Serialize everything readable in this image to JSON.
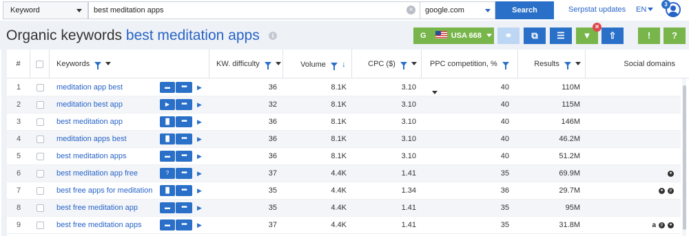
{
  "search": {
    "type_select": "Keyword",
    "query": "best meditation apps",
    "database": "google.com",
    "search_label": "Search"
  },
  "nav": {
    "updates_link": "Serpstat updates",
    "lang": "EN",
    "notif_count": "3"
  },
  "page": {
    "title_prefix": "Organic keywords",
    "title_query": "best meditation apps",
    "info_glyph": "i"
  },
  "toolbar": {
    "db_letter": "G",
    "db_label": "USA 668"
  },
  "table": {
    "headers": {
      "num": "#",
      "keywords": "Keywords",
      "difficulty": "KW. difficulty",
      "volume": "Volume",
      "cpc": "CPC ($)",
      "competition": "PPC competition, %",
      "results": "Results",
      "social": "Social domains"
    },
    "rows": [
      {
        "n": "1",
        "kw": "meditation app best",
        "diff": "36",
        "vol": "8.1K",
        "cpc": "3.10",
        "comp": "40",
        "res": "110M",
        "feature": "speech-bubble-icon",
        "social": []
      },
      {
        "n": "2",
        "kw": "meditation best app",
        "diff": "32",
        "vol": "8.1K",
        "cpc": "3.10",
        "comp": "40",
        "res": "115M",
        "feature": "video-icon",
        "social": []
      },
      {
        "n": "3",
        "kw": "best meditation app",
        "diff": "36",
        "vol": "8.1K",
        "cpc": "3.10",
        "comp": "40",
        "res": "146M",
        "feature": "columns-icon",
        "social": []
      },
      {
        "n": "4",
        "kw": "meditation apps best",
        "diff": "36",
        "vol": "8.1K",
        "cpc": "3.10",
        "comp": "40",
        "res": "46.2M",
        "feature": "columns-icon",
        "social": []
      },
      {
        "n": "5",
        "kw": "best meditation apps",
        "diff": "36",
        "vol": "8.1K",
        "cpc": "3.10",
        "comp": "40",
        "res": "51.2M",
        "feature": "speech-bubble-icon",
        "social": []
      },
      {
        "n": "6",
        "kw": "best meditation app free",
        "diff": "37",
        "vol": "4.4K",
        "cpc": "1.41",
        "comp": "35",
        "res": "69.9M",
        "feature": "question-icon",
        "social": [
          "reddit-icon"
        ]
      },
      {
        "n": "7",
        "kw": "best free apps for meditation",
        "diff": "35",
        "vol": "4.4K",
        "cpc": "1.34",
        "comp": "36",
        "res": "29.7M",
        "feature": "columns-icon",
        "social": [
          "reddit-icon",
          "pinterest-icon"
        ]
      },
      {
        "n": "8",
        "kw": "best free meditation app",
        "diff": "35",
        "vol": "4.4K",
        "cpc": "1.41",
        "comp": "35",
        "res": "95M",
        "feature": "speech-bubble-icon",
        "social": []
      },
      {
        "n": "9",
        "kw": "best free meditation apps",
        "diff": "37",
        "vol": "4.4K",
        "cpc": "1.41",
        "comp": "35",
        "res": "31.8M",
        "feature": "speech-bubble-icon",
        "social": [
          "amazon-icon",
          "pinterest-icon",
          "reddit-icon"
        ]
      }
    ]
  },
  "colors": {
    "accent": "#2a70c8",
    "link": "#2763c7",
    "green": "#78b54a",
    "danger": "#e0474c"
  }
}
